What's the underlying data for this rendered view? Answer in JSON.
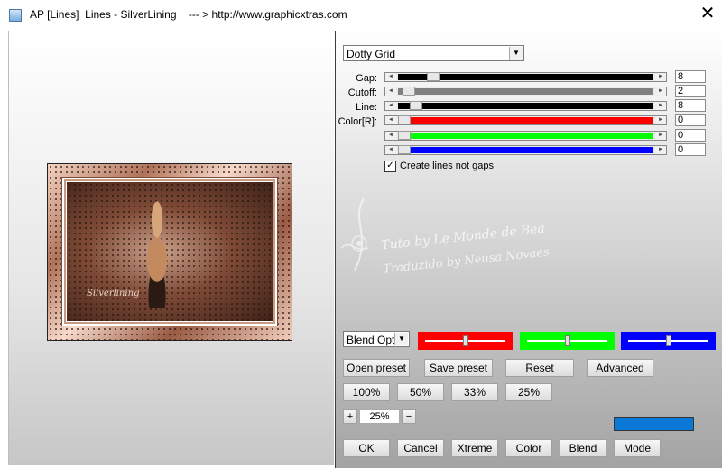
{
  "window": {
    "title": "AP [Lines]  Lines - SilverLining    --- > http://www.graphicxtras.com",
    "close_glyph": "✕"
  },
  "preset_dropdown": {
    "value": "Dotty Grid"
  },
  "sliders": [
    {
      "label": "Gap:",
      "value": "8",
      "color": "#000000",
      "level": 0.12
    },
    {
      "label": "Cutoff:",
      "value": "2",
      "color": "#808080",
      "level": 0.02
    },
    {
      "label": "Line:",
      "value": "8",
      "color": "#000000",
      "level": 0.05
    },
    {
      "label": "Color[R]:",
      "value": "0",
      "color": "#ff0000",
      "level": 0.0
    },
    {
      "label": "",
      "value": "0",
      "color": "#00ff00",
      "level": 0.0
    },
    {
      "label": "",
      "value": "0",
      "color": "#0000ff",
      "level": 0.0
    }
  ],
  "checkbox": {
    "label": "Create lines not gaps",
    "checked": true,
    "glyph": "✓"
  },
  "watermark": {
    "line1": "Tuto by Le Monde de Bea",
    "line2": "Traduzido by Neusa Novaes"
  },
  "preview": {
    "signature": "Silverlining"
  },
  "blend_dropdown": {
    "value": "Blend Optio"
  },
  "color_boxes": [
    {
      "color": "#ff0000",
      "level": 0.5
    },
    {
      "color": "#00ff00",
      "level": 0.5
    },
    {
      "color": "#0000ff",
      "level": 0.5
    }
  ],
  "preset_buttons": {
    "open": "Open preset",
    "save": "Save preset",
    "reset": "Reset",
    "advanced": "Advanced"
  },
  "zoom_buttons": [
    "100%",
    "50%",
    "33%",
    "25%"
  ],
  "zoom_control": {
    "plus": "+",
    "value": "25%",
    "minus": "−"
  },
  "accent_color": "#0a78d6",
  "bottom_buttons": [
    "OK",
    "Cancel",
    "Xtreme",
    "Color",
    "Blend",
    "Mode"
  ]
}
